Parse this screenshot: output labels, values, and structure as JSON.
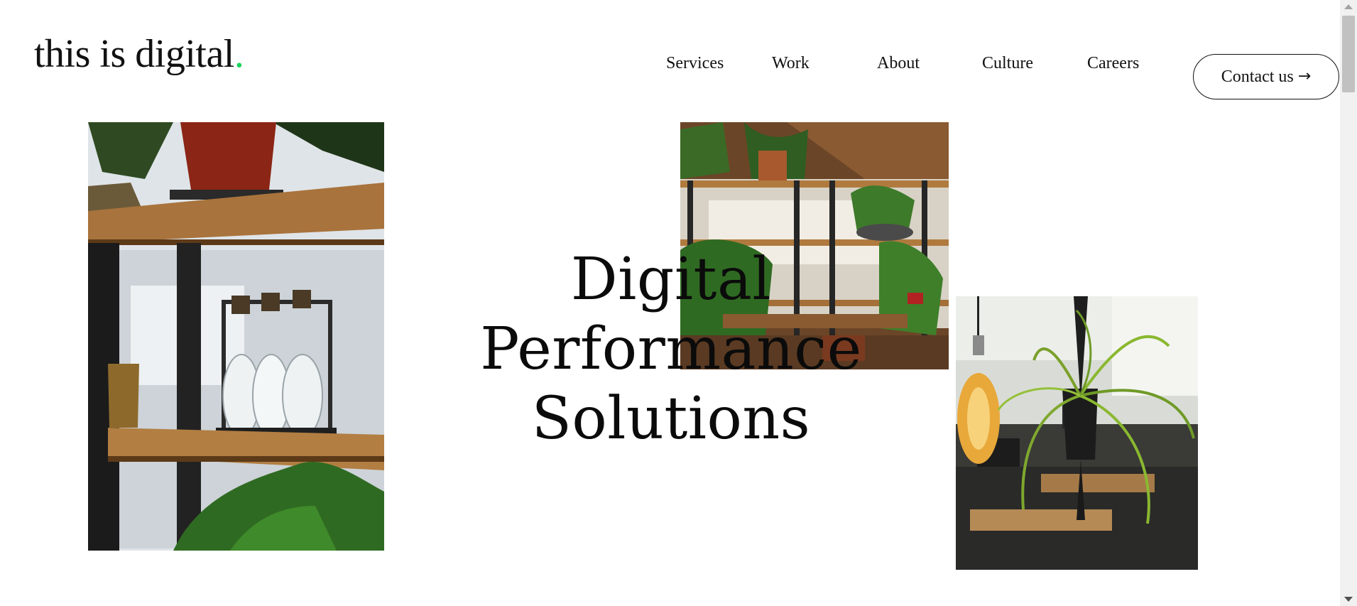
{
  "brand": {
    "logo_text": "this is digital",
    "logo_dot": ".",
    "accent_color": "#19d35c"
  },
  "nav": {
    "items": [
      {
        "label": "Services"
      },
      {
        "label": "Work"
      },
      {
        "label": "About"
      },
      {
        "label": "Culture"
      },
      {
        "label": "Careers"
      }
    ],
    "contact_label": "Contact us",
    "contact_icon": "arrow-right-icon"
  },
  "hero": {
    "line1": "Digital Performance",
    "line2": "Solutions"
  },
  "images": [
    {
      "name": "shelf-with-glass-bottles-photo"
    },
    {
      "name": "office-shelves-with-plants-photo"
    },
    {
      "name": "hanging-plant-and-bulb-photo"
    }
  ]
}
